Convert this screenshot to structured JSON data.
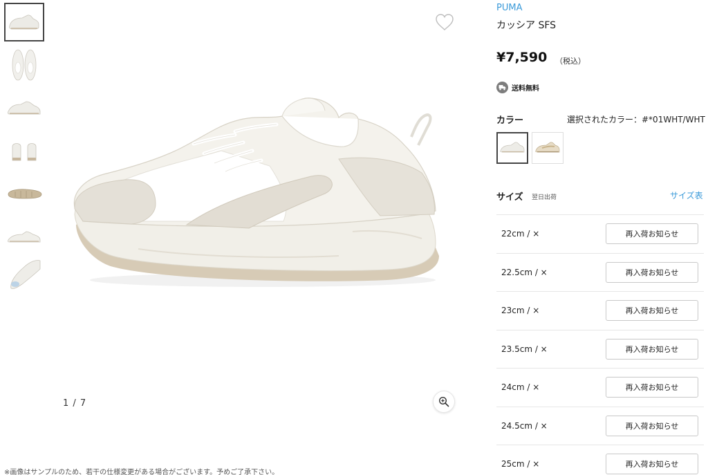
{
  "gallery": {
    "thumbnails": [
      {
        "icon": "shoe-side-thumbnail",
        "active": true
      },
      {
        "icon": "shoe-top-thumbnail",
        "active": false
      },
      {
        "icon": "shoe-angle-thumbnail",
        "active": false
      },
      {
        "icon": "shoe-back-thumbnail",
        "active": false
      },
      {
        "icon": "shoe-sole-thumbnail",
        "active": false
      },
      {
        "icon": "shoe-side-alt-thumbnail",
        "active": false
      },
      {
        "icon": "shoe-front-thumbnail",
        "active": false
      }
    ],
    "counter": "1 / 7",
    "disclaimer": "※画像はサンプルのため、若干の仕様変更がある場合がございます。予めご了承下さい。"
  },
  "product": {
    "brand": "PUMA",
    "name": "カッシア SFS",
    "price": "¥7,590",
    "tax_note": "（税込）",
    "shipping_label": "送料無料"
  },
  "color": {
    "label": "カラー",
    "selected_text": "選択されたカラー：#*01WHT/WHT",
    "swatches": [
      {
        "name": "white",
        "active": true
      },
      {
        "name": "beige",
        "active": false
      }
    ]
  },
  "size": {
    "label": "サイズ",
    "note": "翌日出荷",
    "guide_link": "サイズ表",
    "rows": [
      {
        "size": "22cm / ×",
        "button": "再入荷お知らせ"
      },
      {
        "size": "22.5cm / ×",
        "button": "再入荷お知らせ"
      },
      {
        "size": "23cm / ×",
        "button": "再入荷お知らせ"
      },
      {
        "size": "23.5cm / ×",
        "button": "再入荷お知らせ"
      },
      {
        "size": "24cm / ×",
        "button": "再入荷お知らせ"
      },
      {
        "size": "24.5cm / ×",
        "button": "再入荷お知らせ"
      },
      {
        "size": "25cm / ×",
        "button": "再入荷お知らせ"
      }
    ]
  },
  "colors": {
    "link": "#3a9ad9",
    "border": "#e6e6e6",
    "text": "#222222"
  }
}
